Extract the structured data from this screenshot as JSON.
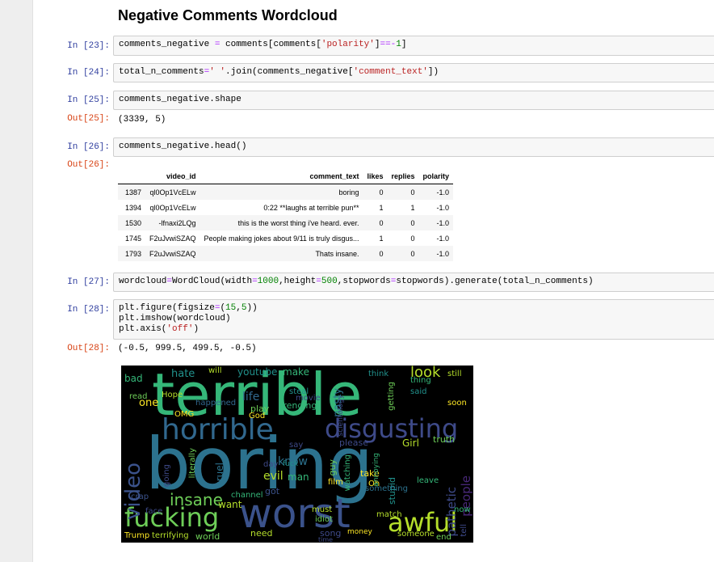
{
  "heading": "Negative Comments Wordcloud",
  "cells": {
    "c23": {
      "prompt": "In [23]:"
    },
    "c24": {
      "prompt": "In [24]:"
    },
    "c25": {
      "prompt": "In [25]:",
      "code": "comments_negative.shape",
      "out_prompt": "Out[25]:",
      "output": "(3339, 5)"
    },
    "c26": {
      "prompt": "In [26]:",
      "code": "comments_negative.head()",
      "out_prompt": "Out[26]:"
    },
    "c27": {
      "prompt": "In [27]:"
    },
    "c28": {
      "prompt": "In [28]:",
      "out_prompt": "Out[28]:",
      "output": "(-0.5, 999.5, 499.5, -0.5)"
    }
  },
  "code_tokens": {
    "c23": {
      "a": "comments_negative ",
      "op1": "=",
      "b": " comments[comments[",
      "s1": "'polarity'",
      "c": "]",
      "op2": "==-",
      "n1": "1",
      "d": "]"
    },
    "c24": {
      "a": "total_n_comments",
      "op1": "=",
      "s1": "' '",
      "b": ".join(comments_negative[",
      "s2": "'comment_text'",
      "c": "])"
    },
    "c27": {
      "a": "wordcloud",
      "op1": "=",
      "b": "WordCloud(width",
      "op2": "=",
      "n1": "1000",
      "c": ",height",
      "op3": "=",
      "n2": "500",
      "d": ",stopwords",
      "op4": "=",
      "e": "stopwords).generate(total_n_comments)"
    },
    "c28": {
      "l1a": "plt.figure(figsize",
      "l1op": "=",
      "l1b": "(",
      "l1n1": "15",
      "l1c": ",",
      "l1n2": "5",
      "l1d": "))",
      "l2": "plt.imshow(wordcloud)",
      "l3a": "plt.axis(",
      "l3s": "'off'",
      "l3b": ")"
    }
  },
  "dataframe": {
    "columns": [
      "video_id",
      "comment_text",
      "likes",
      "replies",
      "polarity"
    ],
    "rows": [
      {
        "index": "1387",
        "video_id": "ql0Op1VcELw",
        "comment_text": "boring",
        "likes": "0",
        "replies": "0",
        "polarity": "-1.0"
      },
      {
        "index": "1394",
        "video_id": "ql0Op1VcELw",
        "comment_text": "0:22 **laughs at terrible pun**",
        "likes": "1",
        "replies": "1",
        "polarity": "-1.0"
      },
      {
        "index": "1530",
        "video_id": "-lfnaxi2LQg",
        "comment_text": "this is the worst thing i've heard. ever.",
        "likes": "0",
        "replies": "0",
        "polarity": "-1.0"
      },
      {
        "index": "1745",
        "video_id": "F2uJvwiSZAQ",
        "comment_text": "People making jokes about 9/11 is truly disgus...",
        "likes": "1",
        "replies": "0",
        "polarity": "-1.0"
      },
      {
        "index": "1793",
        "video_id": "F2uJvwiSZAQ",
        "comment_text": "Thats insane.",
        "likes": "0",
        "replies": "0",
        "polarity": "-1.0"
      }
    ]
  },
  "wordcloud": {
    "words": [
      {
        "text": "terrible",
        "color": "#35b779"
      },
      {
        "text": "boring",
        "color": "#2c728e"
      },
      {
        "text": "horrible",
        "color": "#31688e"
      },
      {
        "text": "disgusting",
        "color": "#3e4a89"
      },
      {
        "text": "worst",
        "color": "#3b528b"
      },
      {
        "text": "fucking",
        "color": "#6ece58"
      },
      {
        "text": "awful",
        "color": "#b5de2b"
      },
      {
        "text": "video",
        "color": "#3b528b"
      },
      {
        "text": "insane",
        "color": "#6ece58"
      },
      {
        "text": "look",
        "color": "#b5de2b"
      },
      {
        "text": "hate",
        "color": "#21918c"
      },
      {
        "text": "youtube",
        "color": "#21918c"
      },
      {
        "text": "make",
        "color": "#35b779"
      },
      {
        "text": "people",
        "color": "#482878"
      },
      {
        "text": "pathetic",
        "color": "#3e4a89"
      },
      {
        "text": "evil",
        "color": "#b5de2b"
      },
      {
        "text": "man",
        "color": "#35b779"
      },
      {
        "text": "know",
        "color": "#2c728e"
      },
      {
        "text": "world",
        "color": "#6ece58"
      },
      {
        "text": "need",
        "color": "#b5de2b"
      },
      {
        "text": "terrifying",
        "color": "#b5de2b"
      },
      {
        "text": "Trump",
        "color": "#fde725"
      },
      {
        "text": "still",
        "color": "#b5de2b"
      },
      {
        "text": "nasty",
        "color": "#2c728e"
      },
      {
        "text": "truth",
        "color": "#6ece58"
      },
      {
        "text": "Girl",
        "color": "#b5de2b"
      },
      {
        "text": "leave",
        "color": "#35b779"
      },
      {
        "text": "face",
        "color": "#3e4a89"
      },
      {
        "text": "stupid",
        "color": "#21918c"
      },
      {
        "text": "song",
        "color": "#3e4a89"
      },
      {
        "text": "idiot",
        "color": "#6ece58"
      },
      {
        "text": "one",
        "color": "#fde725"
      },
      {
        "text": "read",
        "color": "#6ece58"
      },
      {
        "text": "bad",
        "color": "#35b779"
      },
      {
        "text": "life",
        "color": "#31688e"
      },
      {
        "text": "play",
        "color": "#6ece58"
      },
      {
        "text": "trending",
        "color": "#35b779"
      },
      {
        "text": "God",
        "color": "#fde725"
      },
      {
        "text": "Hope",
        "color": "#b5de2b"
      },
      {
        "text": "happened",
        "color": "#31688e"
      },
      {
        "text": "steal",
        "color": "#21918c"
      },
      {
        "text": "movie",
        "color": "#3e4a89"
      },
      {
        "text": "money",
        "color": "#fde725"
      },
      {
        "text": "someone",
        "color": "#b5de2b"
      },
      {
        "text": "end",
        "color": "#6ece58"
      },
      {
        "text": "guy",
        "color": "#6ece58"
      },
      {
        "text": "take",
        "color": "#fde725"
      },
      {
        "text": "film",
        "color": "#fde725"
      },
      {
        "text": "got",
        "color": "#3b528b"
      },
      {
        "text": "channel",
        "color": "#35b779"
      },
      {
        "text": "crap",
        "color": "#3b528b"
      },
      {
        "text": "want",
        "color": "#b5de2b"
      },
      {
        "text": "fuck",
        "color": "#21918c"
      },
      {
        "text": "day",
        "color": "#3e4a89"
      },
      {
        "text": "please",
        "color": "#3e4a89"
      },
      {
        "text": "watching",
        "color": "#35b779"
      },
      {
        "text": "literally",
        "color": "#6ece58"
      },
      {
        "text": "cruel",
        "color": "#2c728e"
      },
      {
        "text": "going",
        "color": "#3e4a89"
      },
      {
        "text": "thing",
        "color": "#35b779"
      },
      {
        "text": "will",
        "color": "#b5de2b"
      },
      {
        "text": "OMG",
        "color": "#fde725"
      },
      {
        "text": "say",
        "color": "#3e4a89"
      },
      {
        "text": "something",
        "color": "#2c728e"
      },
      {
        "text": "must",
        "color": "#b5de2b"
      },
      {
        "text": "match",
        "color": "#b5de2b"
      },
      {
        "text": "getting",
        "color": "#6ece58"
      },
      {
        "text": "said",
        "color": "#21918c"
      },
      {
        "text": "think",
        "color": "#21918c"
      },
      {
        "text": "tell",
        "color": "#3e4a89"
      },
      {
        "text": "time",
        "color": "#3e4a89"
      },
      {
        "text": "Oh",
        "color": "#fde725"
      },
      {
        "text": "now",
        "color": "#35b779"
      },
      {
        "text": "soon",
        "color": "#fde725"
      },
      {
        "text": "annoying",
        "color": "#35b779"
      },
      {
        "text": "scientology",
        "color": "#3e4a89"
      }
    ]
  }
}
